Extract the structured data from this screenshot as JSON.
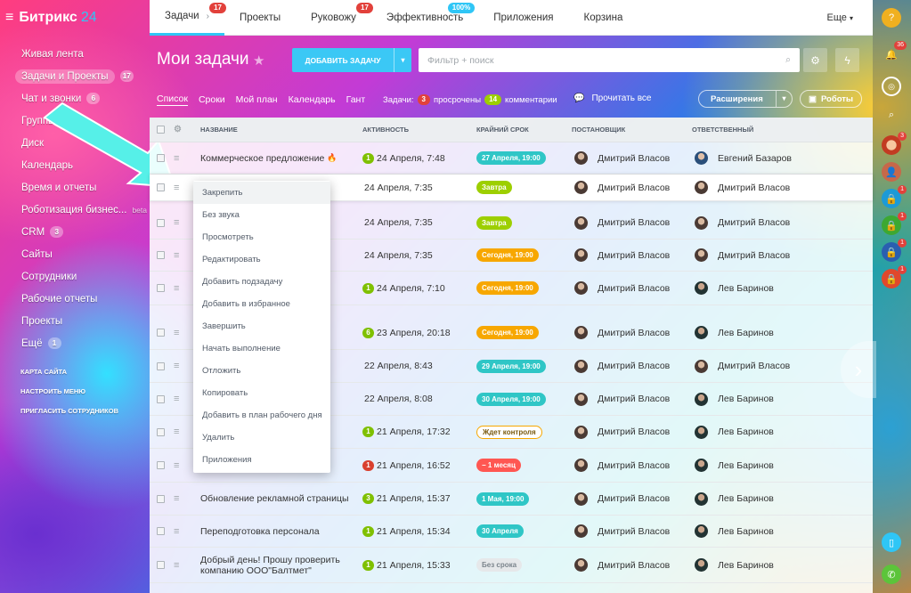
{
  "app": {
    "logo": "Битрикс",
    "logo_accent": "24"
  },
  "sidebar": {
    "items": [
      {
        "label": "Живая лента",
        "count": ""
      },
      {
        "label": "Задачи и Проекты",
        "count": "17"
      },
      {
        "label": "Чат и звонки",
        "count": "6"
      },
      {
        "label": "Группы",
        "count": ""
      },
      {
        "label": "Диск",
        "count": ""
      },
      {
        "label": "Календарь",
        "count": ""
      },
      {
        "label": "Время и отчеты",
        "count": ""
      },
      {
        "label": "Роботизация бизнес...",
        "count": ""
      },
      {
        "label": "CRM",
        "count": "3"
      },
      {
        "label": "Сайты",
        "count": ""
      },
      {
        "label": "Сотрудники",
        "count": ""
      },
      {
        "label": "Рабочие отчеты",
        "count": ""
      },
      {
        "label": "Проекты",
        "count": ""
      },
      {
        "label": "Ещё",
        "count": "1"
      }
    ],
    "beta": "beta",
    "links": [
      "КАРТА САЙТА",
      "НАСТРОИТЬ МЕНЮ",
      "ПРИГЛАСИТЬ СОТРУДНИКОВ"
    ]
  },
  "topbar": {
    "tabs": [
      {
        "label": "Задачи",
        "badge": "17"
      },
      {
        "label": "Проекты",
        "badge": ""
      },
      {
        "label": "Руковожу",
        "badge": "17"
      },
      {
        "label": "Эффективность",
        "badge": "100%"
      },
      {
        "label": "Приложения",
        "badge": ""
      },
      {
        "label": "Корзина",
        "badge": ""
      }
    ],
    "more": "Еще"
  },
  "page": {
    "title": "Мои задачи",
    "add_button": "ДОБАВИТЬ ЗАДАЧУ",
    "filter_placeholder": "Фильтр + поиск",
    "views": [
      "Список",
      "Сроки",
      "Мой план",
      "Календарь",
      "Гант"
    ],
    "counters": {
      "label": "Задачи:",
      "overdue_count": "3",
      "overdue_label": "просрочены",
      "comments_count": "14",
      "comments_label": "комментарии"
    },
    "read_all": "Прочитать все",
    "extensions": "Расширения",
    "robots": "Роботы"
  },
  "table": {
    "columns": [
      "НАЗВАНИЕ",
      "АКТИВНОСТЬ",
      "КРАЙНИЙ СРОК",
      "ПОСТАНОВЩИК",
      "ОТВЕТСТВЕННЫЙ"
    ],
    "rows": [
      {
        "title": "Коммерческое предложение",
        "fire": "🔥",
        "act_badge": "1",
        "act_color": "green",
        "activity": "24 Апреля, 7:48",
        "deadline": "27 Апреля, 19:00",
        "dl_color": "#2fc6c6",
        "creator": "Дмитрий Власов",
        "resp": "Евгений Базаров"
      },
      {
        "title": "",
        "fire": "",
        "act_badge": "",
        "act_color": "",
        "activity": "24 Апреля, 7:35",
        "deadline": "Завтра",
        "dl_color": "#9dcf00",
        "creator": "Дмитрий Власов",
        "resp": "Дмитрий Власов"
      },
      {
        "title": "",
        "fire": "",
        "act_badge": "",
        "act_color": "",
        "activity": "24 Апреля, 7:35",
        "deadline": "Завтра",
        "dl_color": "#9dcf00",
        "creator": "Дмитрий Власов",
        "resp": "Дмитрий Власов"
      },
      {
        "title": "",
        "fire": "",
        "act_badge": "",
        "act_color": "",
        "activity": "24 Апреля, 7:35",
        "deadline": "Сегодня, 19:00",
        "dl_color": "#f7a700",
        "creator": "Дмитрий Власов",
        "resp": "Дмитрий Власов"
      },
      {
        "title": "",
        "fire": "",
        "act_badge": "1",
        "act_color": "green",
        "activity": "24 Апреля, 7:10",
        "deadline": "Сегодня, 19:00",
        "dl_color": "#f7a700",
        "creator": "Дмитрий Власов",
        "resp": "Лев Баринов"
      },
      {
        "title": "",
        "fire": "",
        "act_badge": "6",
        "act_color": "green",
        "activity": "23 Апреля, 20:18",
        "deadline": "Сегодня, 19:00",
        "dl_color": "#f7a700",
        "creator": "Дмитрий Власов",
        "resp": "Лев Баринов"
      },
      {
        "title": "",
        "fire": "",
        "act_badge": "",
        "act_color": "",
        "activity": "22 Апреля, 8:43",
        "deadline": "29 Апреля, 19:00",
        "dl_color": "#2fc6c6",
        "creator": "Дмитрий Власов",
        "resp": "Дмитрий Власов"
      },
      {
        "title": "",
        "fire": "",
        "act_badge": "",
        "act_color": "",
        "activity": "22 Апреля, 8:08",
        "deadline": "30 Апреля, 19:00",
        "dl_color": "#2fc6c6",
        "creator": "Дмитрий Власов",
        "resp": "Лев Баринов"
      },
      {
        "title": "",
        "fire": "",
        "act_badge": "1",
        "act_color": "green",
        "activity": "21 Апреля, 17:32",
        "deadline": "Ждет контроля",
        "dl_color": "outline-orange",
        "creator": "Дмитрий Власов",
        "resp": "Лев Баринов"
      },
      {
        "title": "",
        "fire": "",
        "act_badge": "1",
        "act_color": "red",
        "activity": "21 Апреля, 16:52",
        "deadline": "− 1 месяц",
        "dl_color": "#ff5752",
        "creator": "Дмитрий Власов",
        "resp": "Лев Баринов"
      },
      {
        "title": "Обновление рекламной страницы",
        "fire": "",
        "act_badge": "3",
        "act_color": "green",
        "activity": "21 Апреля, 15:37",
        "deadline": "1 Мая, 19:00",
        "dl_color": "#2fc6c6",
        "creator": "Дмитрий Власов",
        "resp": "Лев Баринов"
      },
      {
        "title": "Переподготовка персонала",
        "fire": "",
        "act_badge": "1",
        "act_color": "green",
        "activity": "21 Апреля, 15:34",
        "deadline": "30 Апреля",
        "dl_color": "#2fc6c6",
        "creator": "Дмитрий Власов",
        "resp": "Лев Баринов"
      },
      {
        "title": "Добрый день! Прошу проверить компанию ООО\"Балтмет\"",
        "fire": "",
        "act_badge": "1",
        "act_color": "green",
        "activity": "21 Апреля, 15:33",
        "deadline": "Без срока",
        "dl_color": "grey",
        "creator": "Дмитрий Власов",
        "resp": "Лев Баринов"
      }
    ]
  },
  "context_menu": [
    "Закрепить",
    "Без звука",
    "Просмотреть",
    "Редактировать",
    "Добавить подзадачу",
    "Добавить в избранное",
    "Завершить",
    "Начать выполнение",
    "Отложить",
    "Копировать",
    "Добавить в план рабочего дня",
    "Удалить",
    "Приложения"
  ],
  "rightbar": {
    "badges": [
      "3",
      "36",
      "3",
      "",
      "1",
      "1",
      "1",
      "1"
    ]
  },
  "colors": {
    "accent": "#2fc6f6",
    "green": "#9dcf00",
    "red": "#e2413b",
    "orange": "#f7a700",
    "teal": "#2fc6c6"
  }
}
